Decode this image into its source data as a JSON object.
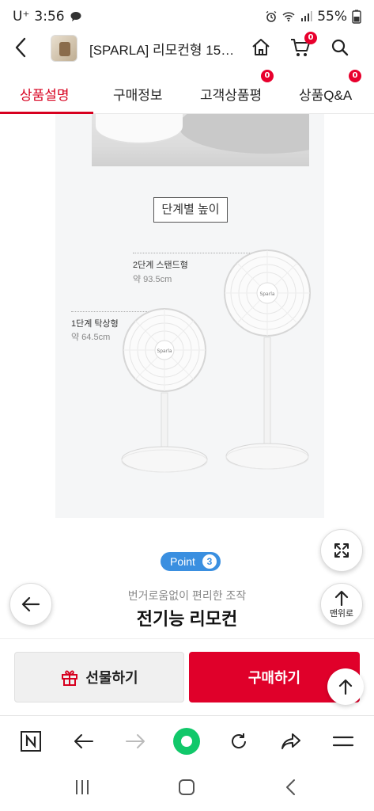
{
  "status_bar": {
    "carrier": "U⁺",
    "time": "3:56",
    "battery": "55%"
  },
  "header": {
    "title": "[SPARLA] 리모컨형 15엽...",
    "cart_count": "0"
  },
  "tabs": [
    {
      "label": "상품설명",
      "active": true
    },
    {
      "label": "구매정보",
      "active": false
    },
    {
      "label": "고객상품평",
      "active": false,
      "badge": "0"
    },
    {
      "label": "상품Q&A",
      "active": false,
      "badge": "0"
    }
  ],
  "content": {
    "section_label": "단계별 높이",
    "fans": [
      {
        "label": "2단계 스탠드형",
        "height": "약 93.5cm"
      },
      {
        "label": "1단계 탁상형",
        "height": "약 64.5cm"
      }
    ],
    "brand_on_fan": "Sparla",
    "point": {
      "label": "Point",
      "number": "3"
    },
    "feature_subtitle": "번거로움없이 편리한 조작",
    "feature_title": "전기능 리모컨"
  },
  "floating": {
    "top_button_label": "맨위로"
  },
  "buy_bar": {
    "gift_label": "선물하기",
    "buy_label": "구매하기"
  },
  "colors": {
    "accent_red": "#d7001f",
    "point_blue": "#3a8fe0"
  }
}
